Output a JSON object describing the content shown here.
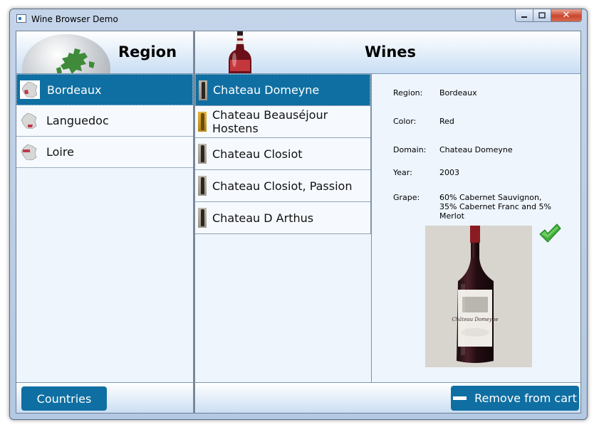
{
  "window": {
    "title": "Wine Browser Demo",
    "min_label": "▭",
    "max_label": "□",
    "close_label": "✕"
  },
  "regions": {
    "header": "Region",
    "items": [
      {
        "label": "Bordeaux",
        "selected": true
      },
      {
        "label": "Languedoc",
        "selected": false
      },
      {
        "label": "Loire",
        "selected": false
      }
    ]
  },
  "wines": {
    "header": "Wines",
    "items": [
      {
        "label": "Chateau Domeyne",
        "selected": true
      },
      {
        "label": "Chateau Beauséjour Hostens",
        "selected": false
      },
      {
        "label": "Chateau Closiot",
        "selected": false
      },
      {
        "label": "Chateau Closiot, Passion",
        "selected": false
      },
      {
        "label": "Chateau D Arthus",
        "selected": false
      }
    ]
  },
  "details": {
    "region_label": "Region:",
    "region_value": "Bordeaux",
    "color_label": "Color:",
    "color_value": "Red",
    "domain_label": "Domain:",
    "domain_value": "Chateau Domeyne",
    "year_label": "Year:",
    "year_value": "2003",
    "grape_label": "Grape:",
    "grape_value": "60% Cabernet Sauvignon, 35% Cabernet Franc and 5% Merlot",
    "label_text": "Château Domeyne"
  },
  "footer": {
    "countries_label": "Countries",
    "remove_label": "Remove from cart"
  },
  "colors": {
    "accent": "#0f6fa2",
    "background": "#eef5fd",
    "wine_red": "#8a1b22"
  }
}
